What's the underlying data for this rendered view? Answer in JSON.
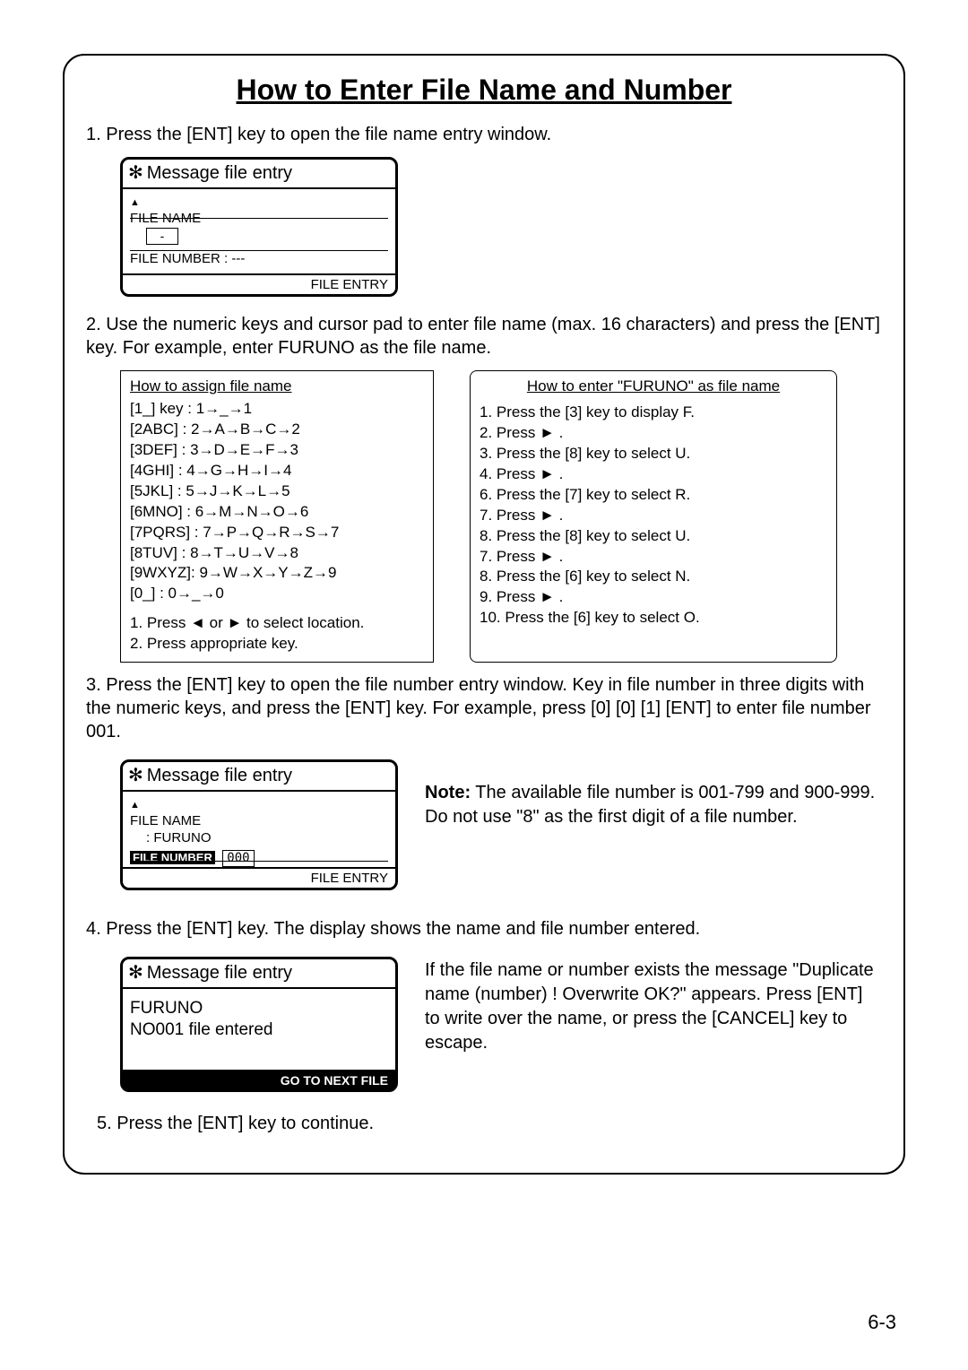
{
  "title": "How to Enter File Name and Number",
  "step1": "1. Press the [ENT] key to open the file name entry window.",
  "dev1": {
    "header": "Message file entry",
    "fileNameLabel": "FILE NAME",
    "fileNumberLabel": "FILE NUMBER",
    "fileNumberVal": ": ---",
    "footer": "FILE ENTRY",
    "cursor": "-"
  },
  "step2": "2. Use the numeric keys and cursor pad to enter file name (max. 16 characters) and press the [ENT] key. For example, enter FURUNO as the file name.",
  "assignBox": {
    "header": "How to assign file name",
    "lines": [
      "[1_] key : 1→_→1",
      "[2ABC]  : 2→A→B→C→2",
      "[3DEF]  : 3→D→E→F→3",
      "[4GHI]   : 4→G→H→I→4",
      "[5JKL]   : 5→J→K→L→5",
      "[6MNO]  : 6→M→N→O→6",
      "[7PQRS] : 7→P→Q→R→S→7",
      "[8TUV]  : 8→T→U→V→8",
      "[9WXYZ]: 9→W→X→Y→Z→9",
      "[0_]        : 0→_→0"
    ],
    "foot1": "1. Press ◄ or ► to select location.",
    "foot2": "2. Press appropriate key."
  },
  "furunoBox": {
    "header": "How to enter \"FURUNO\" as file name",
    "lines": [
      "1. Press the [3] key to display F.",
      "2. Press ► .",
      "3. Press the [8] key to select U.",
      "4. Press ► .",
      "6. Press the [7] key to select R.",
      "7. Press ► .",
      "8. Press the [8] key to select U.",
      "7. Press ► .",
      "8. Press the [6] key to select N.",
      "9. Press ► .",
      "10. Press the [6] key to select O."
    ]
  },
  "step3": "3. Press the [ENT] key to open the file number entry window. Key in file number in three digits with the numeric keys, and press the [ENT] key. For example, press [0] [0] [1] [ENT] to enter file number 001.",
  "dev2": {
    "header": "Message file entry",
    "fileNameLabel": "FILE NAME",
    "fileNameVal": ": FURUNO",
    "fileNumberLabel": "FILE NUMBER",
    "fileNumberVal": "000",
    "footer": "FILE ENTRY"
  },
  "note": {
    "lead": "Note:",
    "body": " The available file number is 001-799 and 900-999. Do not use \"8\" as  the first digit of a file number."
  },
  "step4": "4. Press the [ENT] key. The display shows the name and file number entered.",
  "dev3": {
    "header": "Message file entry",
    "line1": "FURUNO",
    "line2": "NO001 file entered",
    "footer": "GO TO NEXT FILE"
  },
  "side4": "If the file name  or number exists the message \"Duplicate name (number) ! Overwrite OK?\" appears. Press [ENT] to write over the name, or press the [CANCEL] key to escape.",
  "step5": "5. Press the [ENT] key to  continue.",
  "pageNum": "6-3"
}
